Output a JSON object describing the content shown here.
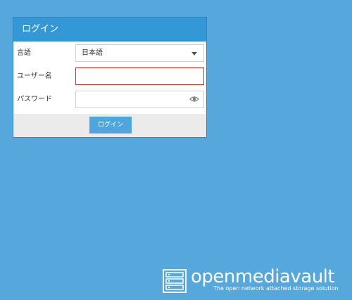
{
  "panel": {
    "title": "ログイン"
  },
  "form": {
    "language": {
      "label": "言語",
      "value": "日本語"
    },
    "username": {
      "label": "ユーザー名",
      "value": ""
    },
    "password": {
      "label": "パスワード",
      "value": ""
    },
    "submit_label": "ログイン"
  },
  "brand": {
    "name": "openmediavault",
    "tagline": "The open network attached storage solution"
  },
  "icons": {
    "select": "chevron-down-icon",
    "password": "eye-icon",
    "logo": "server-rack-icon"
  },
  "colors": {
    "background": "#56a8dc",
    "header": "#3498d6",
    "button": "#4ea6dc",
    "invalid_border": "#c9392b"
  }
}
